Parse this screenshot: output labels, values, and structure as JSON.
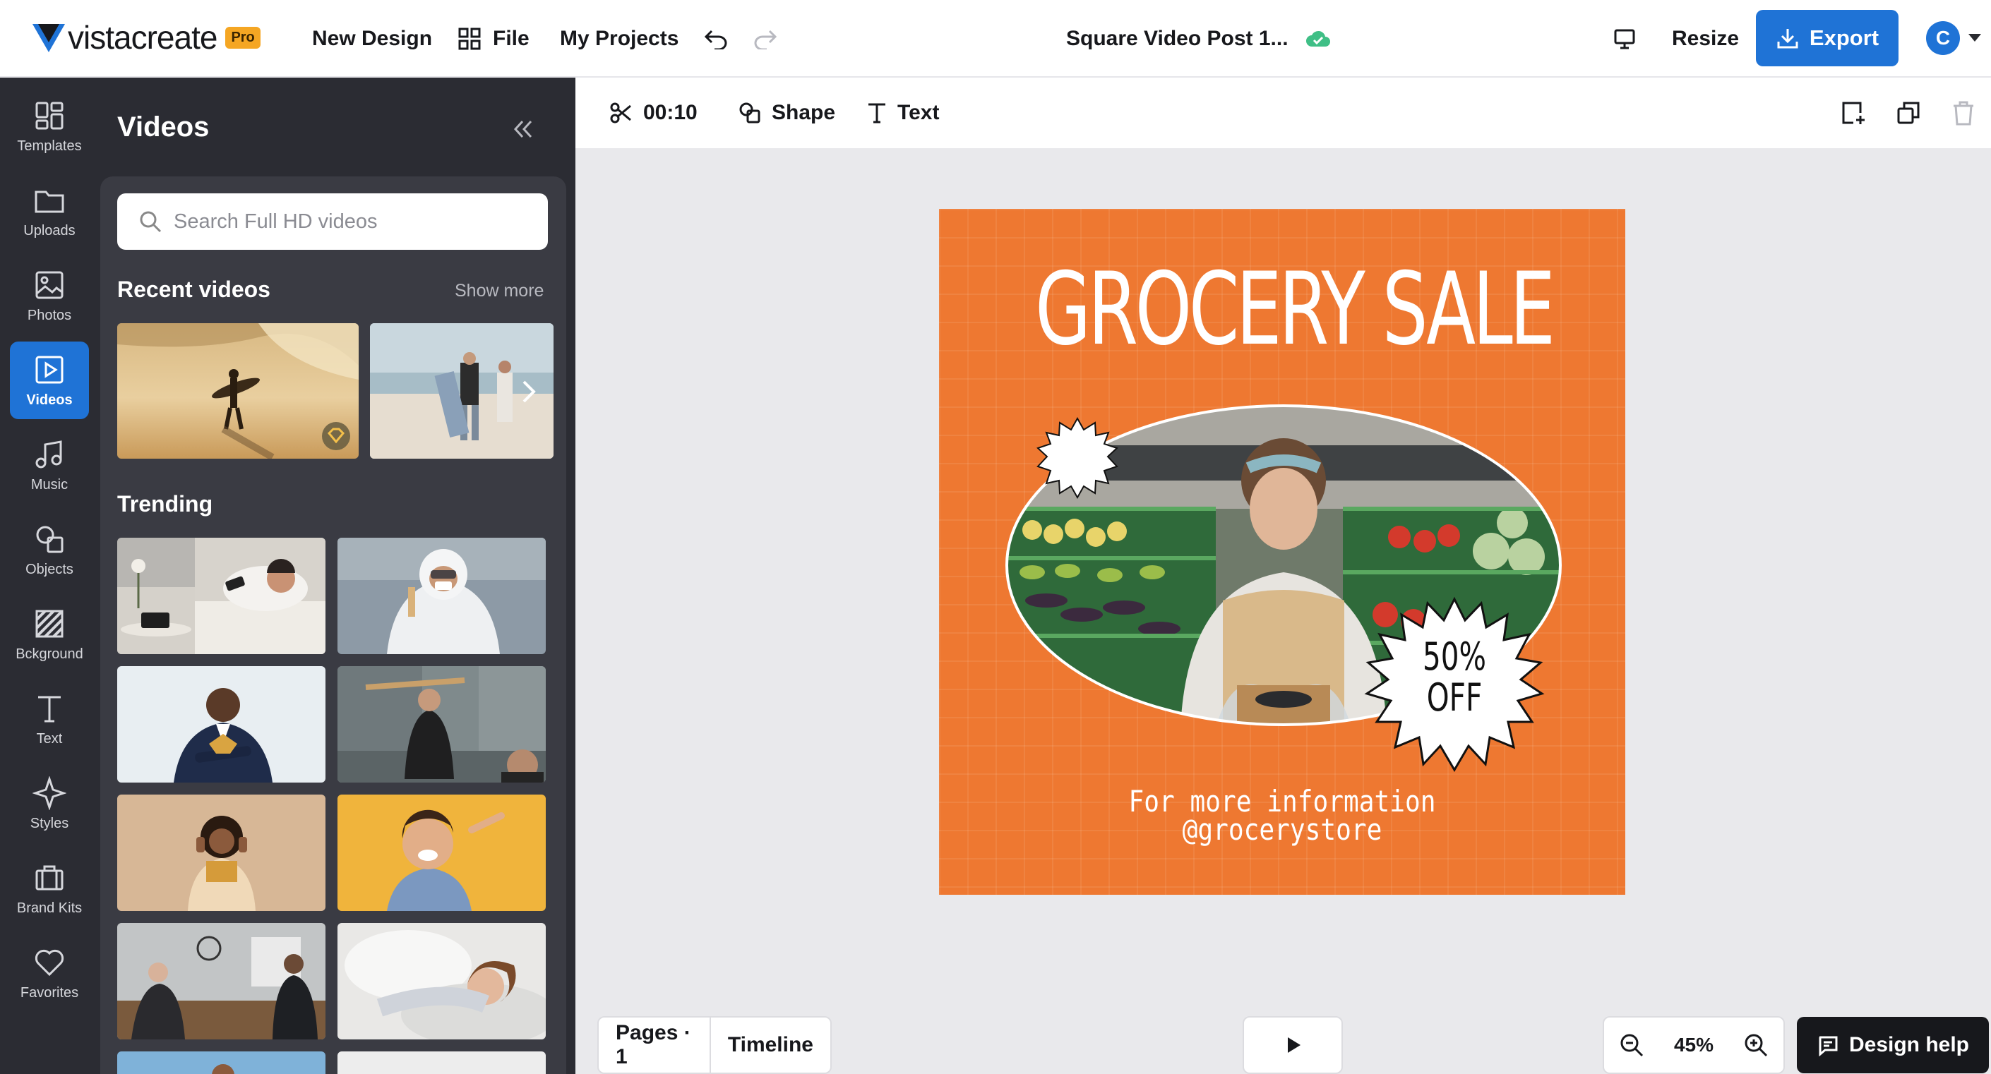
{
  "app": {
    "logo_text": "vistacreate",
    "pro_badge": "Pro"
  },
  "topbar": {
    "new_design": "New Design",
    "file": "File",
    "my_projects": "My Projects",
    "doc_title": "Square Video Post 1...",
    "resize": "Resize",
    "export": "Export",
    "avatar_initial": "C"
  },
  "rail": [
    {
      "label": "Templates",
      "icon": "templates-icon"
    },
    {
      "label": "Uploads",
      "icon": "folder-icon"
    },
    {
      "label": "Photos",
      "icon": "image-icon"
    },
    {
      "label": "Videos",
      "icon": "video-icon",
      "active": true
    },
    {
      "label": "Music",
      "icon": "music-icon"
    },
    {
      "label": "Objects",
      "icon": "shapes-icon"
    },
    {
      "label": "Bckground",
      "icon": "background-icon"
    },
    {
      "label": "Text",
      "icon": "text-icon"
    },
    {
      "label": "Styles",
      "icon": "sparkle-icon"
    },
    {
      "label": "Brand Kits",
      "icon": "briefcase-icon"
    },
    {
      "label": "Favorites",
      "icon": "heart-icon"
    }
  ],
  "panel": {
    "title": "Videos",
    "search_placeholder": "Search Full HD videos",
    "recent_title": "Recent videos",
    "show_more": "Show more",
    "trending_title": "Trending"
  },
  "canvas_toolbar": {
    "duration": "00:10",
    "shape": "Shape",
    "text": "Text"
  },
  "design": {
    "headline": "GROCERY SALE",
    "badge_line1": "50%",
    "badge_line2": "OFF",
    "info_line1": "For more information",
    "info_line2": "@grocerystore",
    "background_color": "#ee7831"
  },
  "bottom": {
    "pages": "Pages · 1",
    "timeline": "Timeline",
    "zoom": "45%",
    "design_help": "Design help"
  },
  "colors": {
    "accent": "#1f73d6",
    "rail_bg": "#2b2c33",
    "panel_inner": "#3a3b43",
    "pro": "#f5a623"
  }
}
